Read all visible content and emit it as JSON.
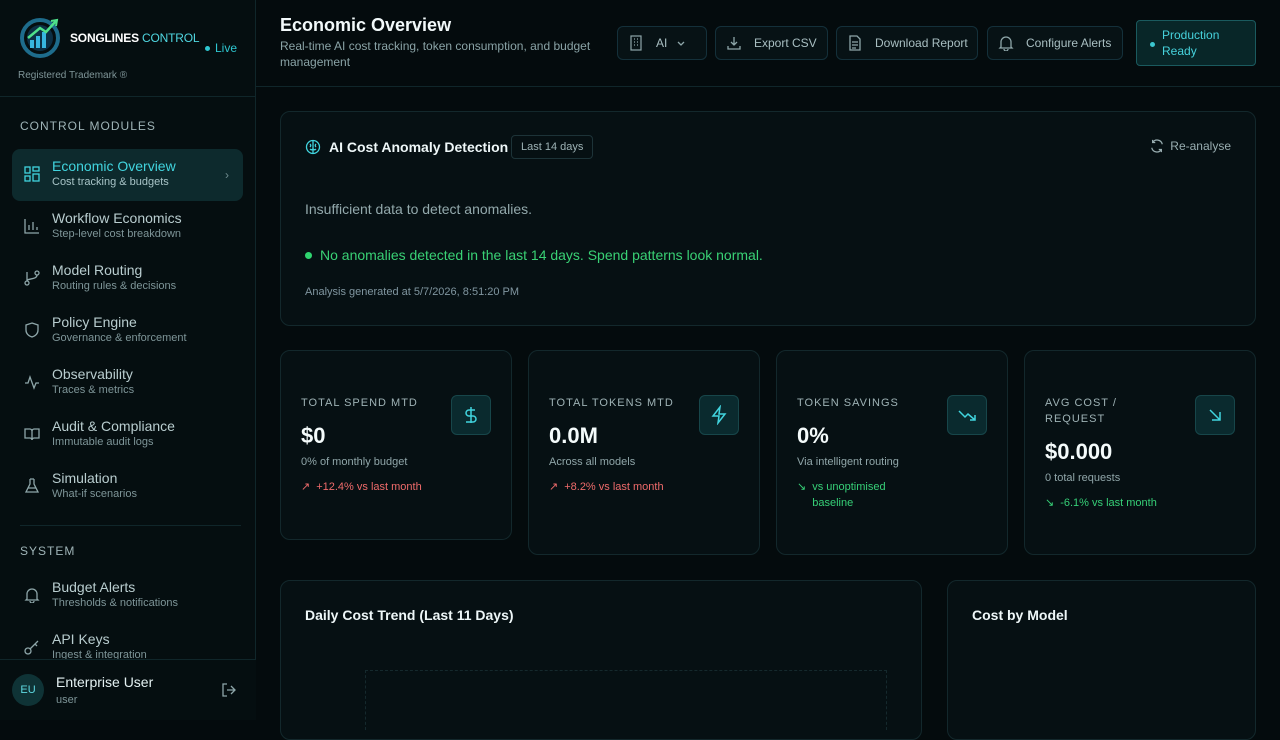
{
  "brand": {
    "name_bold": "SONGLINES",
    "name_light": "CONTROL",
    "live": "Live",
    "trademark": "Registered Trademark ®"
  },
  "sidebar": {
    "sections": [
      {
        "title": "CONTROL MODULES",
        "items": [
          {
            "label": "Economic Overview",
            "sub": "Cost tracking & budgets",
            "icon": "dashboard-icon",
            "active": true
          },
          {
            "label": "Workflow Economics",
            "sub": "Step-level cost breakdown",
            "icon": "bar-chart-icon"
          },
          {
            "label": "Model Routing",
            "sub": "Routing rules & decisions",
            "icon": "git-branch-icon"
          },
          {
            "label": "Policy Engine",
            "sub": "Governance & enforcement",
            "icon": "shield-icon"
          },
          {
            "label": "Observability",
            "sub": "Traces & metrics",
            "icon": "activity-icon"
          },
          {
            "label": "Audit & Compliance",
            "sub": "Immutable audit logs",
            "icon": "book-icon"
          },
          {
            "label": "Simulation",
            "sub": "What-if scenarios",
            "icon": "flask-icon"
          }
        ]
      },
      {
        "title": "SYSTEM",
        "items": [
          {
            "label": "Budget Alerts",
            "sub": "Thresholds & notifications",
            "icon": "bell-icon"
          },
          {
            "label": "API Keys",
            "sub": "Ingest & integration",
            "icon": "key-icon"
          }
        ]
      }
    ],
    "user": {
      "initials": "EU",
      "name": "Enterprise User",
      "role": "user"
    }
  },
  "header": {
    "title": "Economic Overview",
    "subtitle": "Real-time AI cost tracking, token consumption, and budget management",
    "org_select": "AI",
    "export_csv": "Export CSV",
    "download_report": "Download Report",
    "configure_alerts": "Configure Alerts",
    "production_ready": "Production Ready"
  },
  "anomaly": {
    "title": "AI Cost Anomaly Detection",
    "range": "Last 14 days",
    "reanalyse": "Re-analyse",
    "insufficient": "Insufficient data to detect anomalies.",
    "no_anomalies": "No anomalies detected in the last 14 days. Spend patterns look normal.",
    "generated": "Analysis generated at 5/7/2026, 8:51:20 PM"
  },
  "kpis": [
    {
      "label": "TOTAL SPEND MTD",
      "value": "$0",
      "sub": "0% of monthly budget",
      "trend": "+12.4% vs last month",
      "direction": "up",
      "icon": "dollar-icon"
    },
    {
      "label": "TOTAL TOKENS MTD",
      "value": "0.0M",
      "sub": "Across all models",
      "trend": "+8.2% vs last month",
      "direction": "up",
      "icon": "zap-icon"
    },
    {
      "label": "TOKEN SAVINGS",
      "value": "0%",
      "sub": "Via intelligent routing",
      "trend": "vs unoptimised baseline",
      "direction": "down",
      "icon": "trending-down-icon"
    },
    {
      "label": "AVG COST / REQUEST",
      "value": "$0.000",
      "sub": "0 total requests",
      "trend": "-6.1% vs last month",
      "direction": "down",
      "icon": "arrow-down-right-icon"
    }
  ],
  "charts": {
    "daily_trend_title": "Daily Cost Trend (Last 11 Days)",
    "cost_by_model_title": "Cost by Model"
  },
  "colors": {
    "accent": "#41d4de",
    "positive": "#36cf77",
    "negative": "#ef6b6b",
    "background": "#040b0d"
  }
}
